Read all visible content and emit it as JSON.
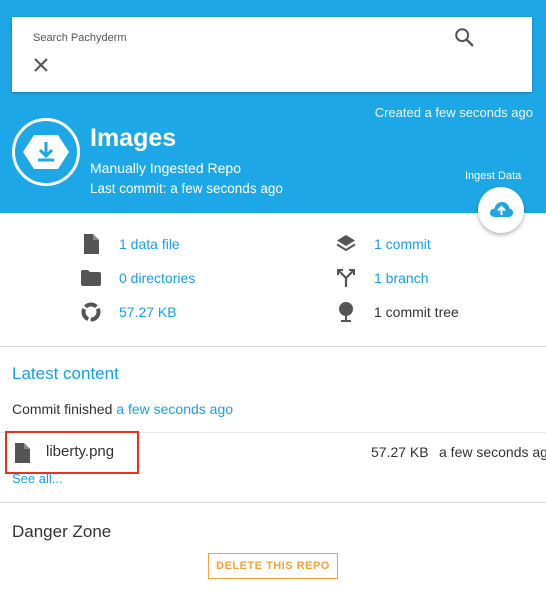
{
  "search": {
    "placeholder": "Search Pachyderm"
  },
  "repo": {
    "created": "Created a few seconds ago",
    "title": "Images",
    "subtitle": "Manually Ingested Repo",
    "last_commit": "Last commit: a few seconds ago",
    "ingest_label": "Ingest Data"
  },
  "stats": {
    "data_files": "1 data file",
    "directories": "0 directories",
    "size": "57.27 KB",
    "commits": "1 commit",
    "branches": "1 branch",
    "commit_tree": "1 commit tree"
  },
  "latest": {
    "title": "Latest content",
    "commit_prefix": "Commit finished",
    "commit_time": "a few seconds ago",
    "files": [
      {
        "name": "liberty.png",
        "size": "57.27 KB",
        "time": "a few seconds ago"
      }
    ],
    "see_all": "See all..."
  },
  "danger": {
    "title": "Danger Zone",
    "delete_label": "DELETE THIS REPO"
  },
  "colors": {
    "header_bg": "#1ea7e6",
    "link": "#1a9fe0",
    "highlight": "#e8321f",
    "danger": "#f3a33a"
  }
}
